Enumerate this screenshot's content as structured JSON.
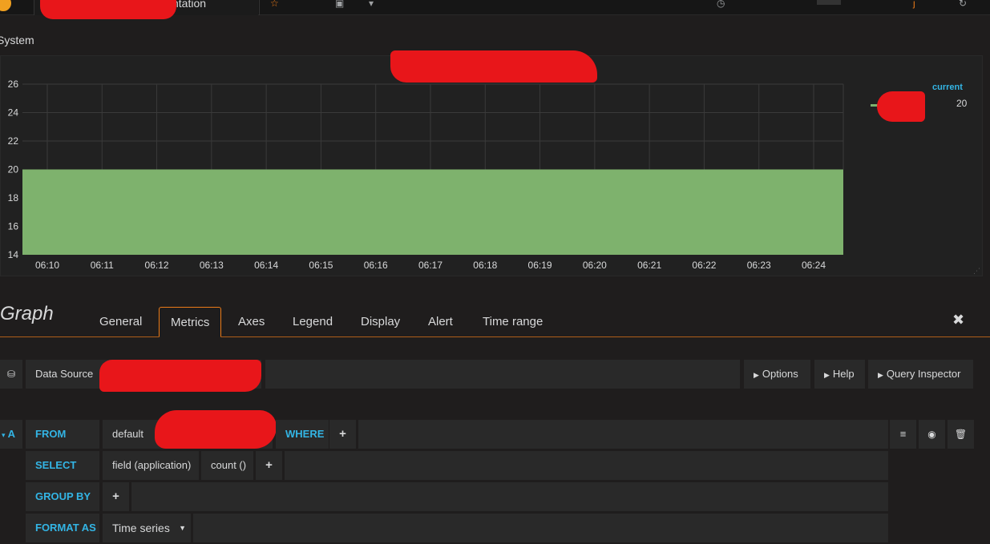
{
  "topbar": {
    "dashboard_title": "ntation",
    "star_icon": "star-icon",
    "share_icon": "share-icon",
    "settings_icon": "gear-icon"
  },
  "panel": {
    "title": "System",
    "legend": {
      "header": "current",
      "value": "20"
    }
  },
  "chart_data": {
    "type": "area",
    "x": [
      "06:10",
      "06:11",
      "06:12",
      "06:13",
      "06:14",
      "06:15",
      "06:16",
      "06:17",
      "06:18",
      "06:19",
      "06:20",
      "06:21",
      "06:22",
      "06:23",
      "06:24"
    ],
    "y_ticks": [
      14,
      16,
      18,
      20,
      22,
      24,
      26
    ],
    "ylim": [
      14,
      26
    ],
    "series": [
      {
        "color": "#7eb26d",
        "values": [
          20,
          20,
          20,
          20,
          20,
          20,
          20,
          20,
          20,
          20,
          20,
          20,
          20,
          20,
          20,
          20
        ]
      }
    ],
    "grid": true,
    "legend_placement": "right"
  },
  "editor": {
    "title": "Graph",
    "tabs": [
      "General",
      "Metrics",
      "Axes",
      "Legend",
      "Display",
      "Alert",
      "Time range"
    ],
    "active_tab": "Metrics",
    "close_label": "✖"
  },
  "datasource_row": {
    "label": "Data Source",
    "options_label": "Options",
    "help_label": "Help",
    "inspector_label": "Query Inspector"
  },
  "query": {
    "ref_id": "A",
    "from_keyword": "FROM",
    "policy": "default",
    "where_keyword": "WHERE",
    "select_keyword": "SELECT",
    "select_field": "field (application)",
    "select_func": "count ()",
    "group_by_keyword": "GROUP BY",
    "format_as_keyword": "FORMAT AS",
    "format_value": "Time series",
    "plus": "+"
  }
}
